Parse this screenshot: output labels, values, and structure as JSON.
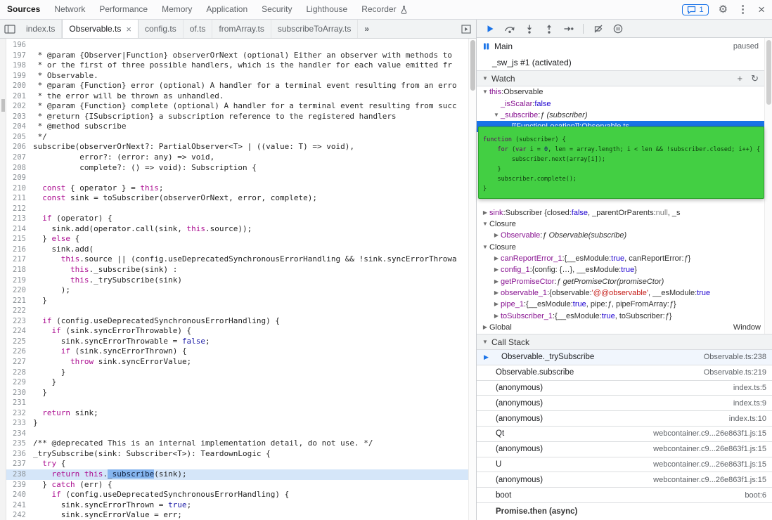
{
  "colors": {
    "accent": "#1a73e8",
    "exec_line_bg": "#d5e6f9",
    "exec_token_bg": "#85b5ef",
    "popup_bg": "#43cf43",
    "code_keyword": "#ab0d90",
    "code_atom": "#1a1aa6",
    "prop_name": "#881391",
    "value_boolean": "#1c00cf",
    "value_string": "#c41a16",
    "value_null": "#808080"
  },
  "main_toolbar": {
    "tabs": [
      {
        "label": "Sources",
        "active": true
      },
      {
        "label": "Network"
      },
      {
        "label": "Performance"
      },
      {
        "label": "Memory"
      },
      {
        "label": "Application"
      },
      {
        "label": "Security"
      },
      {
        "label": "Lighthouse"
      },
      {
        "label": "Recorder",
        "experimental": true
      }
    ],
    "messages_badge": "1"
  },
  "file_tabs": [
    {
      "label": "index.ts"
    },
    {
      "label": "Observable.ts",
      "active": true
    },
    {
      "label": "config.ts"
    },
    {
      "label": "of.ts"
    },
    {
      "label": "fromArray.ts"
    },
    {
      "label": "subscribeToArray.ts"
    },
    {
      "label": "»",
      "overflow": true
    }
  ],
  "editor": {
    "active_line": 238,
    "lines": [
      {
        "n": 196,
        "s": []
      },
      {
        "n": 197,
        "s": [
          [
            "c",
            " * @param {Observer|Function} observerOrNext (optional) Either an observer with methods to"
          ]
        ]
      },
      {
        "n": 198,
        "s": [
          [
            "c",
            " * or the first of three possible handlers, which is the handler for each value emitted fr"
          ]
        ]
      },
      {
        "n": 199,
        "s": [
          [
            "c",
            " * Observable."
          ]
        ]
      },
      {
        "n": 200,
        "s": [
          [
            "c",
            " * @param {Function} error (optional) A handler for a terminal event resulting from an erro"
          ]
        ]
      },
      {
        "n": 201,
        "s": [
          [
            "c",
            " * the error will be thrown as unhandled."
          ]
        ]
      },
      {
        "n": 202,
        "s": [
          [
            "c",
            " * @param {Function} complete (optional) A handler for a terminal event resulting from succ"
          ]
        ]
      },
      {
        "n": 203,
        "s": [
          [
            "c",
            " * @return {ISubscription} a subscription reference to the registered handlers"
          ]
        ]
      },
      {
        "n": 204,
        "s": [
          [
            "c",
            " * @method subscribe"
          ]
        ]
      },
      {
        "n": 205,
        "s": [
          [
            "c",
            " */"
          ]
        ]
      },
      {
        "n": 206,
        "s": [
          [
            "p",
            "subscribe(observerOrNext?: PartialObserver<T> | ((value: T) => void),"
          ]
        ]
      },
      {
        "n": 207,
        "s": [
          [
            "p",
            "          error?: (error: any) => void,"
          ]
        ]
      },
      {
        "n": 208,
        "s": [
          [
            "p",
            "          complete?: () => void): Subscription {"
          ]
        ]
      },
      {
        "n": 209,
        "s": []
      },
      {
        "n": 210,
        "s": [
          [
            "p",
            "  "
          ],
          [
            "k",
            "const"
          ],
          [
            "p",
            " { operator } = "
          ],
          [
            "k",
            "this"
          ],
          [
            "p",
            ";"
          ]
        ]
      },
      {
        "n": 211,
        "s": [
          [
            "p",
            "  "
          ],
          [
            "k",
            "const"
          ],
          [
            "p",
            " sink = toSubscriber(observerOrNext, error, complete);"
          ]
        ]
      },
      {
        "n": 212,
        "s": []
      },
      {
        "n": 213,
        "s": [
          [
            "p",
            "  "
          ],
          [
            "k",
            "if"
          ],
          [
            "p",
            " (operator) {"
          ]
        ]
      },
      {
        "n": 214,
        "s": [
          [
            "p",
            "    sink.add(operator.call(sink, "
          ],
          [
            "k",
            "this"
          ],
          [
            "p",
            ".source));"
          ]
        ]
      },
      {
        "n": 215,
        "s": [
          [
            "p",
            "  } "
          ],
          [
            "k",
            "else"
          ],
          [
            "p",
            " {"
          ]
        ]
      },
      {
        "n": 216,
        "s": [
          [
            "p",
            "    sink.add("
          ]
        ]
      },
      {
        "n": 217,
        "s": [
          [
            "p",
            "      "
          ],
          [
            "k",
            "this"
          ],
          [
            "p",
            ".source || (config.useDeprecatedSynchronousErrorHandling && !sink.syncErrorThrowa"
          ]
        ]
      },
      {
        "n": 218,
        "s": [
          [
            "p",
            "        "
          ],
          [
            "k",
            "this"
          ],
          [
            "p",
            "._subscribe(sink) :"
          ]
        ]
      },
      {
        "n": 219,
        "s": [
          [
            "p",
            "        "
          ],
          [
            "k",
            "this"
          ],
          [
            "p",
            "._trySubscribe(sink)"
          ]
        ]
      },
      {
        "n": 220,
        "s": [
          [
            "p",
            "      );"
          ]
        ]
      },
      {
        "n": 221,
        "s": [
          [
            "p",
            "  }"
          ]
        ]
      },
      {
        "n": 222,
        "s": []
      },
      {
        "n": 223,
        "s": [
          [
            "p",
            "  "
          ],
          [
            "k",
            "if"
          ],
          [
            "p",
            " (config.useDeprecatedSynchronousErrorHandling) {"
          ]
        ]
      },
      {
        "n": 224,
        "s": [
          [
            "p",
            "    "
          ],
          [
            "k",
            "if"
          ],
          [
            "p",
            " (sink.syncErrorThrowable) {"
          ]
        ]
      },
      {
        "n": 225,
        "s": [
          [
            "p",
            "      sink.syncErrorThrowable = "
          ],
          [
            "a",
            "false"
          ],
          [
            "p",
            ";"
          ]
        ]
      },
      {
        "n": 226,
        "s": [
          [
            "p",
            "      "
          ],
          [
            "k",
            "if"
          ],
          [
            "p",
            " (sink.syncErrorThrown) {"
          ]
        ]
      },
      {
        "n": 227,
        "s": [
          [
            "p",
            "        "
          ],
          [
            "k",
            "throw"
          ],
          [
            "p",
            " sink.syncErrorValue;"
          ]
        ]
      },
      {
        "n": 228,
        "s": [
          [
            "p",
            "      }"
          ]
        ]
      },
      {
        "n": 229,
        "s": [
          [
            "p",
            "    }"
          ]
        ]
      },
      {
        "n": 230,
        "s": [
          [
            "p",
            "  }"
          ]
        ]
      },
      {
        "n": 231,
        "s": []
      },
      {
        "n": 232,
        "s": [
          [
            "p",
            "  "
          ],
          [
            "k",
            "return"
          ],
          [
            "p",
            " sink;"
          ]
        ]
      },
      {
        "n": 233,
        "s": [
          [
            "p",
            "}"
          ]
        ]
      },
      {
        "n": 234,
        "s": []
      },
      {
        "n": 235,
        "s": [
          [
            "c",
            "/** @deprecated This is an internal implementation detail, do not use. */"
          ]
        ]
      },
      {
        "n": 236,
        "s": [
          [
            "p",
            "_trySubscribe(sink: Subscriber<T>): TeardownLogic {"
          ]
        ]
      },
      {
        "n": 237,
        "s": [
          [
            "p",
            "  "
          ],
          [
            "k",
            "try"
          ],
          [
            "p",
            " {"
          ]
        ]
      },
      {
        "n": 238,
        "s": [
          [
            "p",
            "    "
          ],
          [
            "k",
            "return"
          ],
          [
            "p",
            " "
          ],
          [
            "k",
            "this"
          ],
          [
            "p",
            "."
          ],
          [
            "sel",
            "_subscribe"
          ],
          [
            "p",
            "(sink);"
          ]
        ]
      },
      {
        "n": 239,
        "s": [
          [
            "p",
            "  } "
          ],
          [
            "k",
            "catch"
          ],
          [
            "p",
            " (err) {"
          ]
        ]
      },
      {
        "n": 240,
        "s": [
          [
            "p",
            "    "
          ],
          [
            "k",
            "if"
          ],
          [
            "p",
            " (config.useDeprecatedSynchronousErrorHandling) {"
          ]
        ]
      },
      {
        "n": 241,
        "s": [
          [
            "p",
            "      sink.syncErrorThrown = "
          ],
          [
            "a",
            "true"
          ],
          [
            "p",
            ";"
          ]
        ]
      },
      {
        "n": 242,
        "s": [
          [
            "p",
            "      sink.syncErrorValue = err;"
          ]
        ]
      }
    ]
  },
  "debugger_sidebar": {
    "controls": [
      "resume",
      "step-over",
      "step-into",
      "step-out",
      "step",
      "separator",
      "deactivate-breakpoints",
      "pause-on-exceptions"
    ],
    "threads": [
      {
        "label": "Main",
        "status": "paused",
        "paused_icon": true
      },
      {
        "label": "_sw_js #1 (activated)"
      }
    ],
    "watch": {
      "title": "Watch",
      "rows": [
        {
          "ind": 0,
          "arrow": "▼",
          "name": "this",
          "ncls": "prop",
          "val": [
            [
              "p",
              "Observable"
            ]
          ]
        },
        {
          "ind": 1,
          "arrow": "",
          "name": "_isScalar",
          "ncls": "prop",
          "val": [
            [
              "b",
              "false"
            ]
          ]
        },
        {
          "ind": 1,
          "arrow": "▼",
          "name": "_subscribe",
          "ncls": "prop",
          "val": [
            [
              "fi",
              "ƒ (subscriber)"
            ]
          ]
        },
        {
          "ind": 2,
          "arrow": "",
          "name": "[[FunctionLocation]]",
          "ncls": "prop",
          "selected": true,
          "val": [
            [
              "p",
              "Observable.ts"
            ]
          ]
        },
        {
          "type": "spacer"
        },
        {
          "ind": 0,
          "arrow": "▶",
          "name": "sink",
          "ncls": "prop",
          "val": [
            [
              "p",
              "Subscriber {closed: "
            ],
            [
              "b",
              "false"
            ],
            [
              "p",
              ", _parentOrParents: "
            ],
            [
              "nl",
              "null"
            ],
            [
              "p",
              ", _s"
            ]
          ]
        },
        {
          "ind": 0,
          "arrow": "▼",
          "name": "Closure",
          "ncls": "plain",
          "val": []
        },
        {
          "ind": 1,
          "arrow": "▶",
          "name": "Observable",
          "ncls": "prop",
          "val": [
            [
              "fi",
              "ƒ Observable(subscribe)"
            ]
          ]
        },
        {
          "ind": 0,
          "arrow": "▼",
          "name": "Closure",
          "ncls": "plain",
          "val": []
        },
        {
          "ind": 1,
          "arrow": "▶",
          "name": "canReportError_1",
          "ncls": "prop",
          "val": [
            [
              "p",
              "{__esModule: "
            ],
            [
              "b",
              "true"
            ],
            [
              "p",
              ", canReportError: "
            ],
            [
              "fi",
              "ƒ"
            ],
            [
              "p",
              "}"
            ]
          ]
        },
        {
          "ind": 1,
          "arrow": "▶",
          "name": "config_1",
          "ncls": "prop",
          "val": [
            [
              "p",
              "{config: {…}, __esModule: "
            ],
            [
              "b",
              "true"
            ],
            [
              "p",
              "}"
            ]
          ]
        },
        {
          "ind": 1,
          "arrow": "▶",
          "name": "getPromiseCtor",
          "ncls": "prop",
          "val": [
            [
              "fi",
              "ƒ getPromiseCtor(promiseCtor)"
            ]
          ]
        },
        {
          "ind": 1,
          "arrow": "▶",
          "name": "observable_1",
          "ncls": "prop",
          "val": [
            [
              "p",
              "{observable: "
            ],
            [
              "s",
              "'@@observable'"
            ],
            [
              "p",
              ", __esModule: "
            ],
            [
              "b",
              "true"
            ]
          ]
        },
        {
          "ind": 1,
          "arrow": "▶",
          "name": "pipe_1",
          "ncls": "prop",
          "val": [
            [
              "p",
              "{__esModule: "
            ],
            [
              "b",
              "true"
            ],
            [
              "p",
              ", pipe: "
            ],
            [
              "fi",
              "ƒ"
            ],
            [
              "p",
              ", pipeFromArray: "
            ],
            [
              "fi",
              "ƒ"
            ],
            [
              "p",
              "}"
            ]
          ]
        },
        {
          "ind": 1,
          "arrow": "▶",
          "name": "toSubscriber_1",
          "ncls": "prop",
          "val": [
            [
              "p",
              "{__esModule: "
            ],
            [
              "b",
              "true"
            ],
            [
              "p",
              ", toSubscriber: "
            ],
            [
              "fi",
              "ƒ"
            ],
            [
              "p",
              "}"
            ]
          ]
        },
        {
          "ind": 0,
          "arrow": "▶",
          "name": "Global",
          "ncls": "plain",
          "val": [],
          "right": "Window"
        }
      ]
    },
    "function_popup": {
      "lines": [
        [
          [
            "k",
            "function"
          ],
          [
            "p",
            " (subscriber) {"
          ]
        ],
        [
          [
            "p",
            "    "
          ],
          [
            "k",
            "for"
          ],
          [
            "p",
            " ("
          ],
          [
            "k",
            "var"
          ],
          [
            "p",
            " i = "
          ],
          [
            "n",
            "0"
          ],
          [
            "p",
            ", len = array.length; i < len && !subscriber.closed; i++) {"
          ]
        ],
        [
          [
            "p",
            "        subscriber.next(array[i]);"
          ]
        ],
        [
          [
            "p",
            "    }"
          ]
        ],
        [
          [
            "p",
            "    subscriber.complete();"
          ]
        ],
        [
          [
            "p",
            "}"
          ]
        ]
      ]
    },
    "call_stack": {
      "title": "Call Stack",
      "frames": [
        {
          "name": "Observable._trySubscribe",
          "loc": "Observable.ts:238",
          "active": true
        },
        {
          "name": "Observable.subscribe",
          "loc": "Observable.ts:219"
        },
        {
          "name": "(anonymous)",
          "loc": "index.ts:5"
        },
        {
          "name": "(anonymous)",
          "loc": "index.ts:9"
        },
        {
          "name": "(anonymous)",
          "loc": "index.ts:10"
        },
        {
          "name": "Qt",
          "loc": "webcontainer.c9...26e863f1.js:15"
        },
        {
          "name": "(anonymous)",
          "loc": "webcontainer.c9...26e863f1.js:15"
        },
        {
          "name": "U",
          "loc": "webcontainer.c9...26e863f1.js:15"
        },
        {
          "name": "(anonymous)",
          "loc": "webcontainer.c9...26e863f1.js:15"
        },
        {
          "name": "boot",
          "loc": "boot:6"
        }
      ],
      "async_boundary": "Promise.then (async)"
    }
  }
}
